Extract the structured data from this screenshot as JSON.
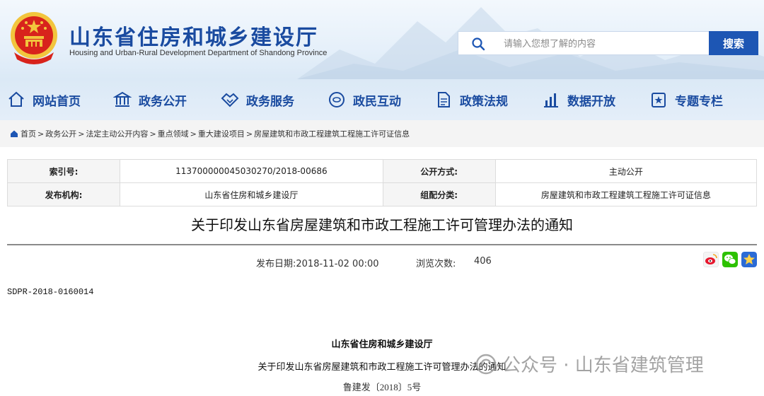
{
  "header": {
    "title": "山东省住房和城乡建设厅",
    "subtitle": "Housing and Urban-Rural Development Department of Shandong Province"
  },
  "search": {
    "placeholder": "请输入您想了解的内容",
    "button_label": "搜索"
  },
  "nav": {
    "items": [
      {
        "label": "网站首页",
        "icon": "home-icon"
      },
      {
        "label": "政务公开",
        "icon": "government-building-icon"
      },
      {
        "label": "政务服务",
        "icon": "handshake-icon"
      },
      {
        "label": "政民互动",
        "icon": "interaction-icon"
      },
      {
        "label": "政策法规",
        "icon": "document-icon"
      },
      {
        "label": "数据开放",
        "icon": "bar-chart-icon"
      },
      {
        "label": "专题专栏",
        "icon": "topic-icon"
      }
    ]
  },
  "breadcrumb": {
    "items": [
      "首页",
      "政务公开",
      "法定主动公开内容",
      "重点领域",
      "重大建设项目",
      "房屋建筑和市政工程建筑工程施工许可证信息"
    ],
    "separator": ">"
  },
  "info": {
    "index_label": "索引号:",
    "index_value": "113700000045030270/2018-00686",
    "mode_label": "公开方式:",
    "mode_value": "主动公开",
    "org_label": "发布机构:",
    "org_value": "山东省住房和城乡建设厅",
    "category_label": "组配分类:",
    "category_value": "房屋建筑和市政工程建筑工程施工许可证信息"
  },
  "article": {
    "title": "关于印发山东省房屋建筑和市政工程施工许可管理办法的通知",
    "publish_date": "发布日期:2018-11-02 00:00",
    "views_label": "浏览次数:",
    "views_value": "406",
    "doc_code": "SDPR-2018-0160014",
    "body_issuer": "山东省住房和城乡建设厅",
    "body_title": "关于印发山东省房屋建筑和市政工程施工许可管理办法的通知",
    "body_number": "鲁建发〔2018〕5号"
  },
  "watermark": {
    "text": "公众号 · 山东省建筑管理"
  },
  "colors": {
    "brand_blue": "#1a4ba0",
    "button_blue": "#1d56b4",
    "emblem_red": "#d8231c",
    "emblem_gold": "#f2c53d"
  }
}
